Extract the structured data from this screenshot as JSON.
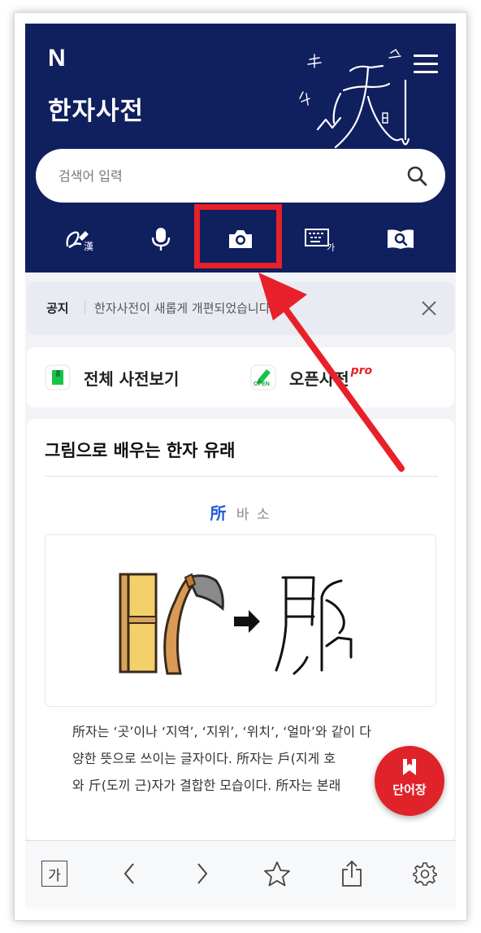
{
  "app": {
    "logo": "N",
    "title": "한자사전"
  },
  "search": {
    "placeholder": "검색어 입력"
  },
  "tools": [
    {
      "icon": "handwriting-hanja-icon"
    },
    {
      "icon": "microphone-icon"
    },
    {
      "icon": "camera-icon"
    },
    {
      "icon": "keyboard-icon"
    },
    {
      "icon": "book-search-icon"
    }
  ],
  "notice": {
    "label": "공지",
    "text": "한자사전이 새롭게 개편되었습니다."
  },
  "shortcuts": {
    "all_dict": "전체 사전보기",
    "open_dict": "오픈사전",
    "open_badge": "OPEN",
    "pro_badge": "pro"
  },
  "card": {
    "title": "그림으로 배우는 한자 유래",
    "hanja": "所",
    "reading": "바 소",
    "desc_lines": [
      "所자는 ‘곳’이나 ‘지역’, ‘지위’, ‘위치’, ‘얼마’와 같이 다",
      "양한 뜻으로 쓰이는 글자이다. 所자는 戶(지게 호",
      "와 斤(도끼 근)자가 결합한 모습이다. 所자는 본래"
    ]
  },
  "fab": {
    "label": "단어장"
  },
  "bottombar": {
    "font_label": "가",
    "items": [
      "font-size-icon",
      "back-icon",
      "forward-icon",
      "star-icon",
      "share-icon",
      "settings-icon"
    ]
  },
  "colors": {
    "header_bg": "#101f5e",
    "accent_red": "#e8202a",
    "hanja_blue": "#1f5bd7"
  }
}
